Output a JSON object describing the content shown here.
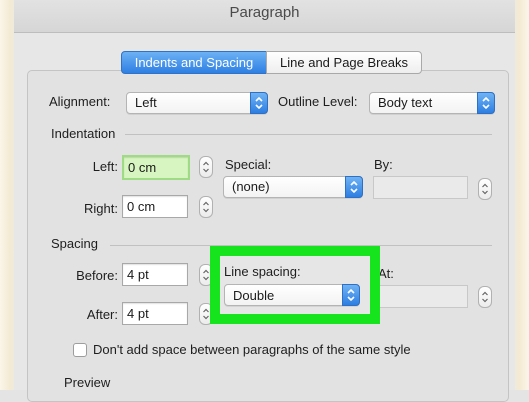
{
  "window": {
    "title": "Paragraph"
  },
  "tabs": [
    {
      "label": "Indents and Spacing",
      "active": true
    },
    {
      "label": "Line and Page Breaks",
      "active": false
    }
  ],
  "general": {
    "alignment_label": "Alignment:",
    "alignment_value": "Left",
    "outline_level_label": "Outline Level:",
    "outline_level_value": "Body text"
  },
  "indentation": {
    "section_label": "Indentation",
    "left_label": "Left:",
    "left_value": "0 cm",
    "right_label": "Right:",
    "right_value": "0 cm",
    "special_label": "Special:",
    "special_value": "(none)",
    "by_label": "By:",
    "by_value": ""
  },
  "spacing": {
    "section_label": "Spacing",
    "before_label": "Before:",
    "before_value": "4 pt",
    "after_label": "After:",
    "after_value": "4 pt",
    "line_spacing_label": "Line spacing:",
    "line_spacing_value": "Double",
    "at_label": "At:",
    "at_value": "",
    "dont_add_space_label": "Don't add space between paragraphs of the same style",
    "dont_add_space_checked": false
  },
  "preview": {
    "label": "Preview"
  },
  "colors": {
    "accent": "#2e7fe3",
    "highlight": "#16e51d",
    "focus_field": "#d6f5c0"
  },
  "icons": {
    "popup_arrows": "up-down-chevron-icon",
    "stepper": "stepper-arrows-icon"
  }
}
